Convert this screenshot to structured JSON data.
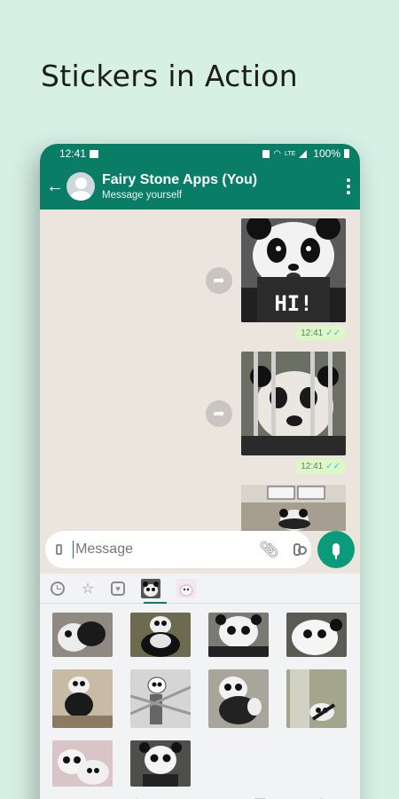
{
  "headline": "Stickers in Action",
  "statusbar": {
    "time": "12:41",
    "lte": "LTE",
    "battery": "100%"
  },
  "appbar": {
    "title": "Fairy Stone Apps (You)",
    "subtitle": "Message yourself"
  },
  "messages": [
    {
      "sticker": "panda-hi",
      "text": "HI!",
      "time": "12:41"
    },
    {
      "sticker": "panda-bars",
      "time": "12:41"
    },
    {
      "sticker": "panda-window"
    }
  ],
  "input": {
    "placeholder": "Message"
  },
  "picker": {
    "tabs": [
      "recent-icon",
      "favorites-icon",
      "heart-icon",
      "pack-panda",
      "pack-cat"
    ],
    "stickers": [
      "s1",
      "s2",
      "s3",
      "s4",
      "s5",
      "s6",
      "s7",
      "s8",
      "s9",
      "s10"
    ]
  },
  "colors": {
    "accent": "#0a7d67",
    "background": "#d6f0e5",
    "chat": "#ece5dd",
    "bubble": "#dcf8c6"
  }
}
